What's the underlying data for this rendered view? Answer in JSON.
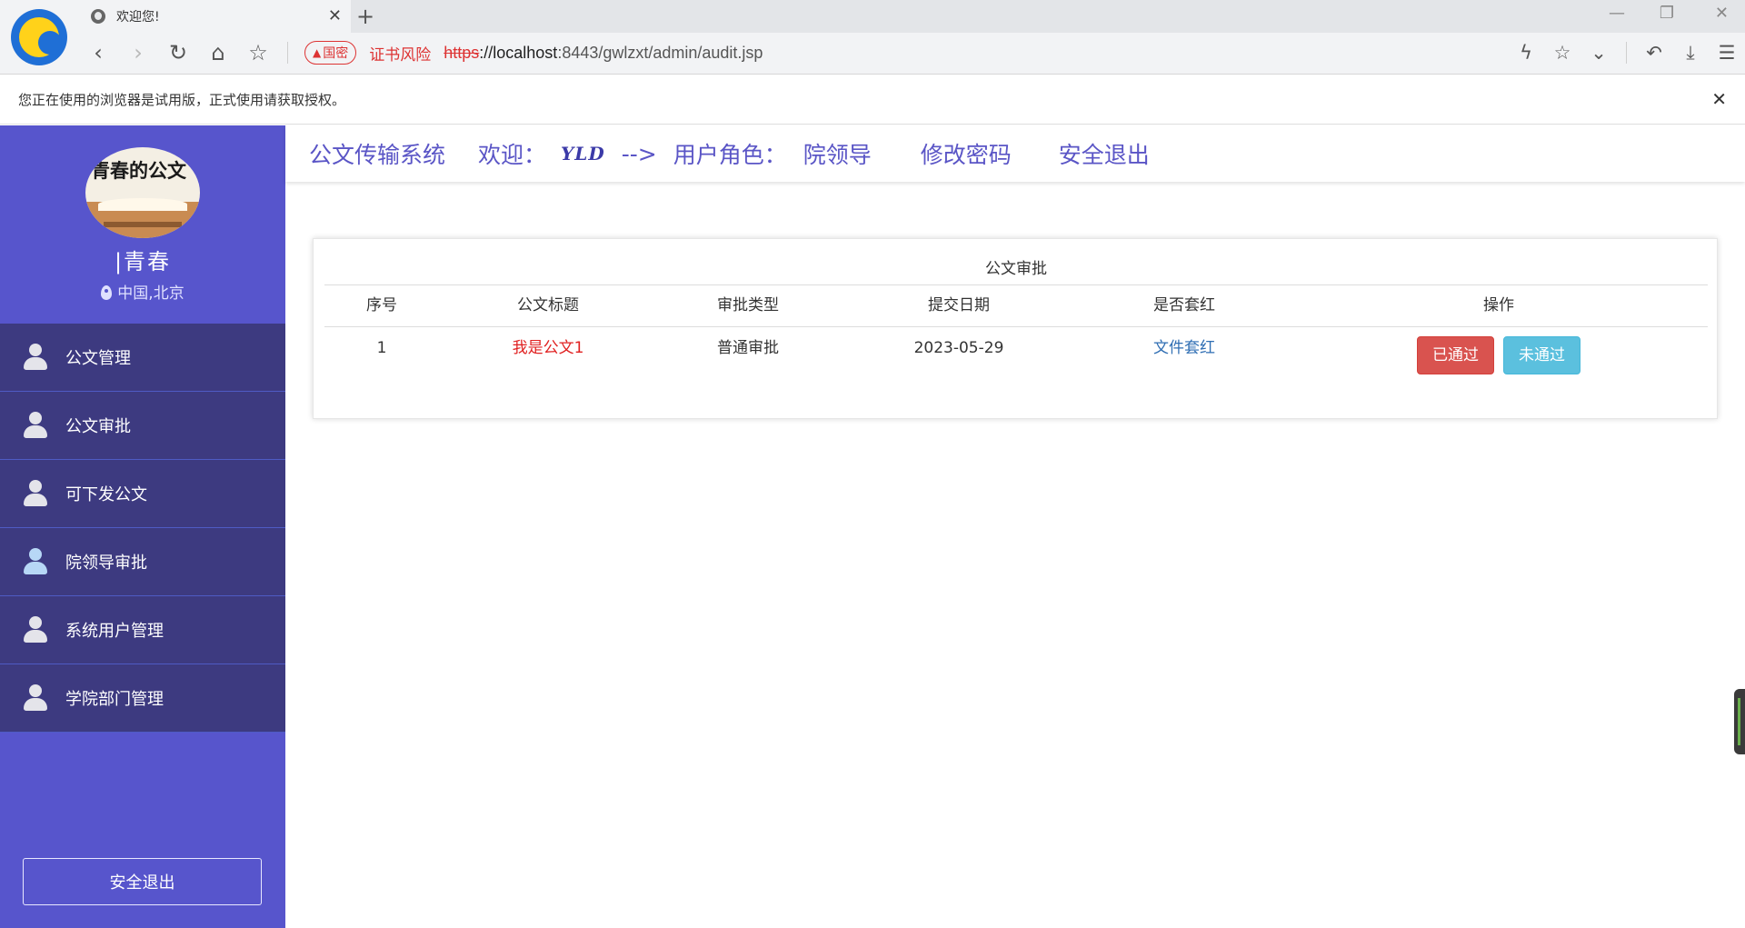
{
  "browser": {
    "tab_title": "欢迎您!",
    "new_tab_symbol": "+",
    "tab_close_symbol": "✕",
    "gm_badge": "国密",
    "cert_warning": "证书风险",
    "url_scheme": "https",
    "url_host": "://localhost",
    "url_rest": ":8443/gwlzxt/admin/audit.jsp",
    "notice": "您正在使用的浏览器是试用版，正式使用请获取授权。",
    "notice_close": "✕"
  },
  "sidebar": {
    "avatar_text": "青春的公文",
    "name": "青春",
    "location": "中国,北京",
    "items": [
      {
        "label": "公文管理"
      },
      {
        "label": "公文审批"
      },
      {
        "label": "可下发公文"
      },
      {
        "label": "院领导审批"
      },
      {
        "label": "系统用户管理"
      },
      {
        "label": "学院部门管理"
      }
    ],
    "logout_label": "安全退出"
  },
  "topbar": {
    "system_name": "公文传输系统",
    "welcome_label": "欢迎：",
    "username": "YLD",
    "arrow": "-->",
    "role_label": "用户角色：",
    "role": "院领导",
    "change_password": "修改密码",
    "logout": "安全退出"
  },
  "table": {
    "caption": "公文审批",
    "headers": [
      "序号",
      "公文标题",
      "审批类型",
      "提交日期",
      "是否套红",
      "操作"
    ],
    "rows": [
      {
        "index": "1",
        "title": "我是公文1",
        "type": "普通审批",
        "date": "2023-05-29",
        "redhead": "文件套红",
        "approve_label": "已通过",
        "reject_label": "未通过"
      }
    ]
  },
  "colors": {
    "sidebar_bg": "#5755cc",
    "menu_bg": "#3d3a80",
    "accent_text": "#5a55c6",
    "danger": "#d9534f",
    "info": "#5bc0de",
    "link": "#2f6eb3"
  }
}
